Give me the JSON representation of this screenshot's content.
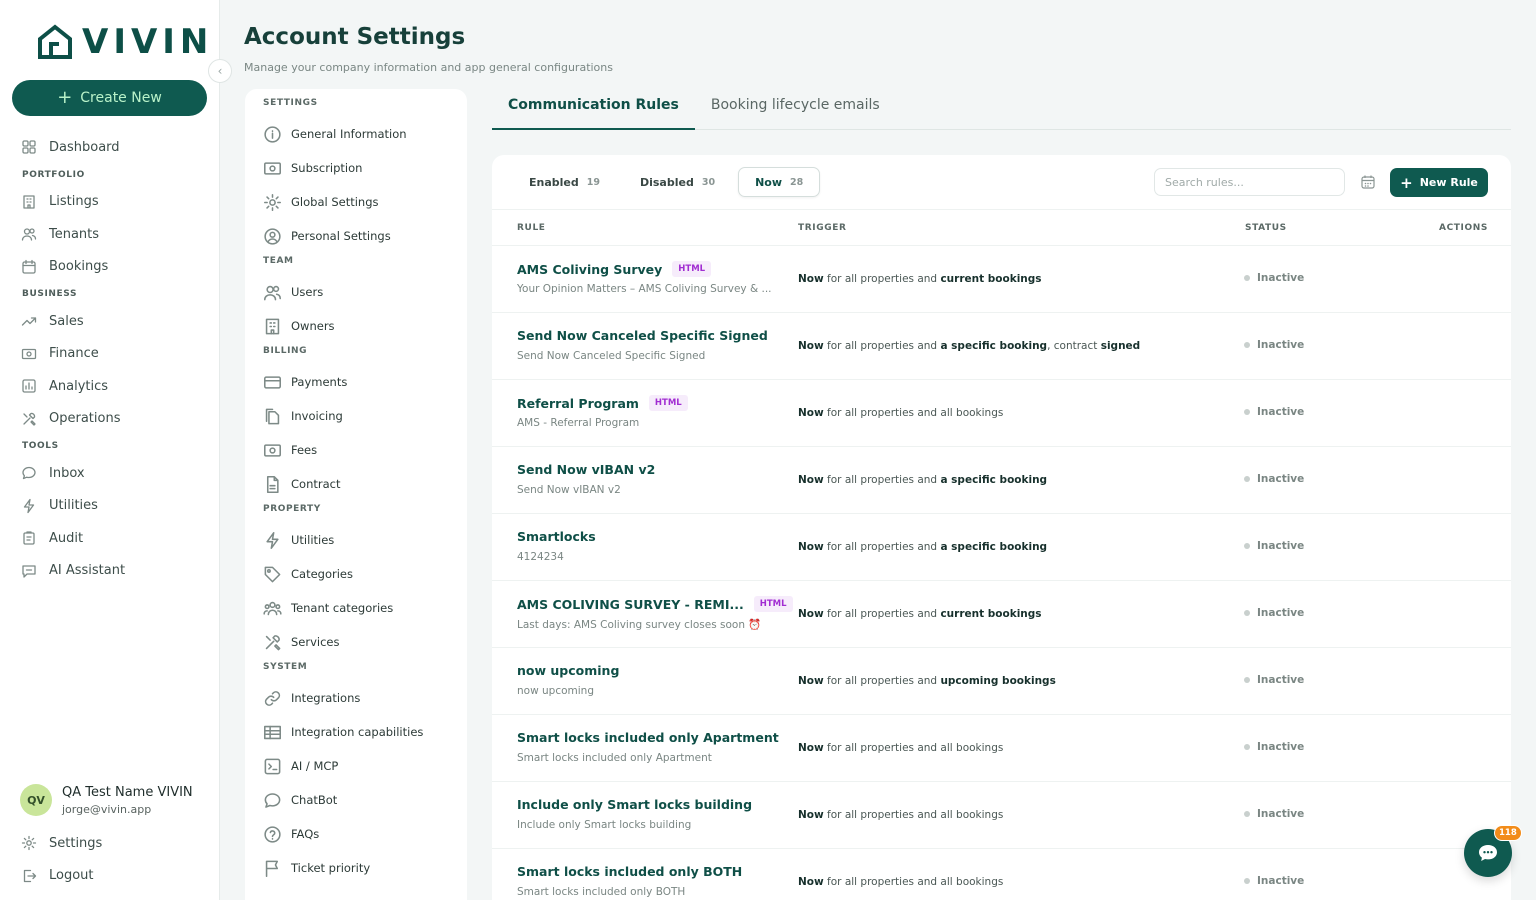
{
  "brand": {
    "name": "VIVIN"
  },
  "sidebar": {
    "create_label": "Create New",
    "items": [
      {
        "type": "item",
        "label": "Dashboard",
        "icon": "dashboard-icon"
      },
      {
        "type": "section",
        "label": "PORTFOLIO"
      },
      {
        "type": "item",
        "label": "Listings",
        "icon": "building-icon"
      },
      {
        "type": "item",
        "label": "Tenants",
        "icon": "users-icon"
      },
      {
        "type": "item",
        "label": "Bookings",
        "icon": "calendar-icon"
      },
      {
        "type": "section",
        "label": "BUSINESS"
      },
      {
        "type": "item",
        "label": "Sales",
        "icon": "trend-icon"
      },
      {
        "type": "item",
        "label": "Finance",
        "icon": "money-icon"
      },
      {
        "type": "item",
        "label": "Analytics",
        "icon": "chart-icon"
      },
      {
        "type": "item",
        "label": "Operations",
        "icon": "tools-icon"
      },
      {
        "type": "section",
        "label": "TOOLS"
      },
      {
        "type": "item",
        "label": "Inbox",
        "icon": "chat-icon"
      },
      {
        "type": "item",
        "label": "Utilities",
        "icon": "bolt-icon"
      },
      {
        "type": "item",
        "label": "Audit",
        "icon": "clipboard-icon"
      },
      {
        "type": "item",
        "label": "AI Assistant",
        "icon": "ai-chat-icon"
      }
    ],
    "user": {
      "initials": "QV",
      "name": "QA Test Name VIVIN",
      "email": "jorge@vivin.app"
    },
    "bottom": [
      {
        "label": "Settings",
        "icon": "gear-icon"
      },
      {
        "label": "Logout",
        "icon": "logout-icon"
      }
    ]
  },
  "header": {
    "title": "Account Settings",
    "subtitle": "Manage your company information and app general configurations"
  },
  "settings_menu": [
    {
      "type": "section",
      "label": "SETTINGS"
    },
    {
      "type": "item",
      "label": "General Information",
      "icon": "info-icon"
    },
    {
      "type": "item",
      "label": "Subscription",
      "icon": "money-icon"
    },
    {
      "type": "item",
      "label": "Global Settings",
      "icon": "gear-icon"
    },
    {
      "type": "item",
      "label": "Personal Settings",
      "icon": "user-circle-icon"
    },
    {
      "type": "section",
      "label": "TEAM"
    },
    {
      "type": "item",
      "label": "Users",
      "icon": "users-icon"
    },
    {
      "type": "item",
      "label": "Owners",
      "icon": "building-icon"
    },
    {
      "type": "section",
      "label": "BILLING"
    },
    {
      "type": "item",
      "label": "Payments",
      "icon": "card-icon"
    },
    {
      "type": "item",
      "label": "Invoicing",
      "icon": "document-copy-icon"
    },
    {
      "type": "item",
      "label": "Fees",
      "icon": "money-icon"
    },
    {
      "type": "item",
      "label": "Contract",
      "icon": "document-icon"
    },
    {
      "type": "section",
      "label": "PROPERTY"
    },
    {
      "type": "item",
      "label": "Utilities",
      "icon": "bolt-icon"
    },
    {
      "type": "item",
      "label": "Categories",
      "icon": "tag-icon"
    },
    {
      "type": "item",
      "label": "Tenant categories",
      "icon": "group-icon"
    },
    {
      "type": "item",
      "label": "Services",
      "icon": "tools-icon"
    },
    {
      "type": "section",
      "label": "SYSTEM"
    },
    {
      "type": "item",
      "label": "Integrations",
      "icon": "link-icon"
    },
    {
      "type": "item",
      "label": "Integration capabilities",
      "icon": "table-icon"
    },
    {
      "type": "item",
      "label": "AI / MCP",
      "icon": "terminal-icon"
    },
    {
      "type": "item",
      "label": "ChatBot",
      "icon": "chat-icon"
    },
    {
      "type": "item",
      "label": "FAQs",
      "icon": "question-icon"
    },
    {
      "type": "item",
      "label": "Ticket priority",
      "icon": "flag-icon"
    }
  ],
  "tabs": [
    {
      "label": "Communication Rules",
      "active": true
    },
    {
      "label": "Booking lifecycle emails",
      "active": false
    }
  ],
  "filters": [
    {
      "label": "Enabled",
      "count": "19",
      "active": false
    },
    {
      "label": "Disabled",
      "count": "30",
      "active": false
    },
    {
      "label": "Now",
      "count": "28",
      "active": true
    }
  ],
  "search": {
    "placeholder": "Search rules..."
  },
  "new_rule_label": "New Rule",
  "table": {
    "headers": {
      "rule": "RULE",
      "trigger": "TRIGGER",
      "status": "STATUS",
      "actions": "ACTIONS"
    },
    "rows": [
      {
        "name": "AMS Coliving Survey",
        "badge": "HTML",
        "sub": "Your Opinion Matters – AMS Coliving Survey & ...",
        "trigger": [
          [
            "b",
            "Now"
          ],
          [
            "t",
            " for all properties and "
          ],
          [
            "b",
            "current bookings"
          ]
        ],
        "status": "Inactive"
      },
      {
        "name": "Send Now Canceled Specific Signed",
        "badge": "",
        "sub": "Send Now Canceled Specific Signed",
        "trigger": [
          [
            "b",
            "Now"
          ],
          [
            "t",
            " for all properties and "
          ],
          [
            "b",
            "a specific booking"
          ],
          [
            "t",
            ", contract "
          ],
          [
            "b",
            "signed"
          ]
        ],
        "status": "Inactive"
      },
      {
        "name": "Referral Program",
        "badge": "HTML",
        "sub": "AMS - Referral Program",
        "trigger": [
          [
            "b",
            "Now"
          ],
          [
            "t",
            " for all properties and all bookings"
          ]
        ],
        "status": "Inactive"
      },
      {
        "name": "Send Now vIBAN v2",
        "badge": "",
        "sub": "Send Now vIBAN v2",
        "trigger": [
          [
            "b",
            "Now"
          ],
          [
            "t",
            " for all properties and "
          ],
          [
            "b",
            "a specific booking"
          ]
        ],
        "status": "Inactive"
      },
      {
        "name": "Smartlocks",
        "badge": "",
        "sub": "4124234",
        "trigger": [
          [
            "b",
            "Now"
          ],
          [
            "t",
            " for all properties and "
          ],
          [
            "b",
            "a specific booking"
          ]
        ],
        "status": "Inactive"
      },
      {
        "name": "AMS COLIVING SURVEY - REMI...",
        "badge": "HTML",
        "sub": "Last days: AMS Coliving survey closes soon ⏰",
        "trigger": [
          [
            "b",
            "Now"
          ],
          [
            "t",
            " for all properties and "
          ],
          [
            "b",
            "current bookings"
          ]
        ],
        "status": "Inactive"
      },
      {
        "name": "now upcoming",
        "badge": "",
        "sub": "now upcoming",
        "trigger": [
          [
            "b",
            "Now"
          ],
          [
            "t",
            " for all properties and "
          ],
          [
            "b",
            "upcoming bookings"
          ]
        ],
        "status": "Inactive"
      },
      {
        "name": "Smart locks included only Apartment",
        "badge": "",
        "sub": "Smart locks included only Apartment",
        "trigger": [
          [
            "b",
            "Now"
          ],
          [
            "t",
            " for all properties and all bookings"
          ]
        ],
        "status": "Inactive"
      },
      {
        "name": "Include only Smart locks building",
        "badge": "",
        "sub": "Include only Smart locks building",
        "trigger": [
          [
            "b",
            "Now"
          ],
          [
            "t",
            " for all properties and all bookings"
          ]
        ],
        "status": "Inactive"
      },
      {
        "name": "Smart locks included only BOTH",
        "badge": "",
        "sub": "Smart locks included only BOTH",
        "trigger": [
          [
            "b",
            "Now"
          ],
          [
            "t",
            " for all properties and all bookings"
          ]
        ],
        "status": "Inactive"
      }
    ]
  },
  "chat": {
    "badge": "118"
  },
  "colors": {
    "primary": "#0f5a50",
    "accent": "#b9f2c9",
    "badge_purple": "#a12dd2",
    "notification": "#f28c1a"
  }
}
